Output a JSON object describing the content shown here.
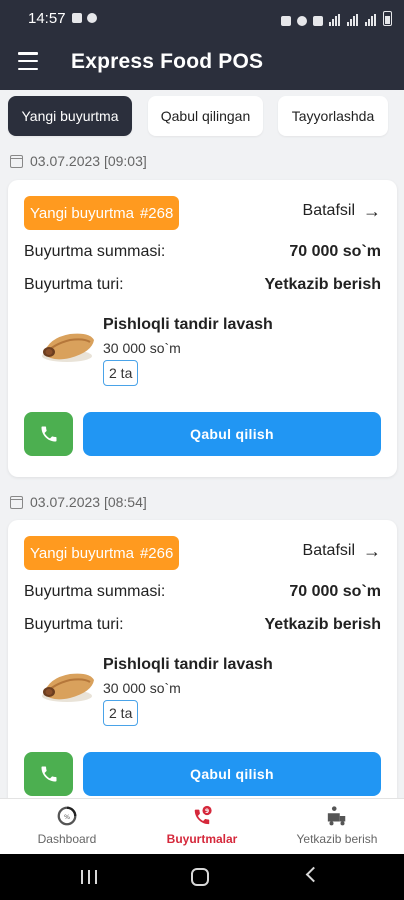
{
  "status_bar": {
    "time": "14:57"
  },
  "app": {
    "title": "Express Food POS"
  },
  "tabs": [
    {
      "label": "Yangi buyurtma",
      "active": true
    },
    {
      "label": "Qabul qilingan",
      "active": false
    },
    {
      "label": "Tayyorlashda",
      "active": false
    }
  ],
  "orders": [
    {
      "date": "03.07.2023 [09:03]",
      "badge": "Yangi buyurtma",
      "number": "#268",
      "details_label": "Batafsil",
      "sum_label": "Buyurtma summasi:",
      "sum_value": "70 000 so`m",
      "type_label": "Buyurtma turi:",
      "type_value": "Yetkazib berish",
      "item": {
        "name": "Pishloqli tandir lavash",
        "price": "30 000 so`m",
        "qty": "2 ta"
      },
      "accept_label": "Qabul qilish"
    },
    {
      "date": "03.07.2023 [08:54]",
      "badge": "Yangi buyurtma",
      "number": "#266",
      "details_label": "Batafsil",
      "sum_label": "Buyurtma summasi:",
      "sum_value": "70 000 so`m",
      "type_label": "Buyurtma turi:",
      "type_value": "Yetkazib berish",
      "item": {
        "name": "Pishloqli tandir lavash",
        "price": "30 000 so`m",
        "qty": "2 ta"
      },
      "accept_label": "Qabul qilish"
    }
  ],
  "bottom_nav": [
    {
      "label": "Dashboard",
      "icon": "dashboard-icon",
      "active": false
    },
    {
      "label": "Buyurtmalar",
      "icon": "orders-icon",
      "active": true
    },
    {
      "label": "Yetkazib berish",
      "icon": "delivery-icon",
      "active": false
    }
  ],
  "colors": {
    "header": "#2b2f3c",
    "badge": "#ff9a1f",
    "accept": "#2196f3",
    "call": "#4caf50",
    "nav_active": "#d5283b"
  }
}
